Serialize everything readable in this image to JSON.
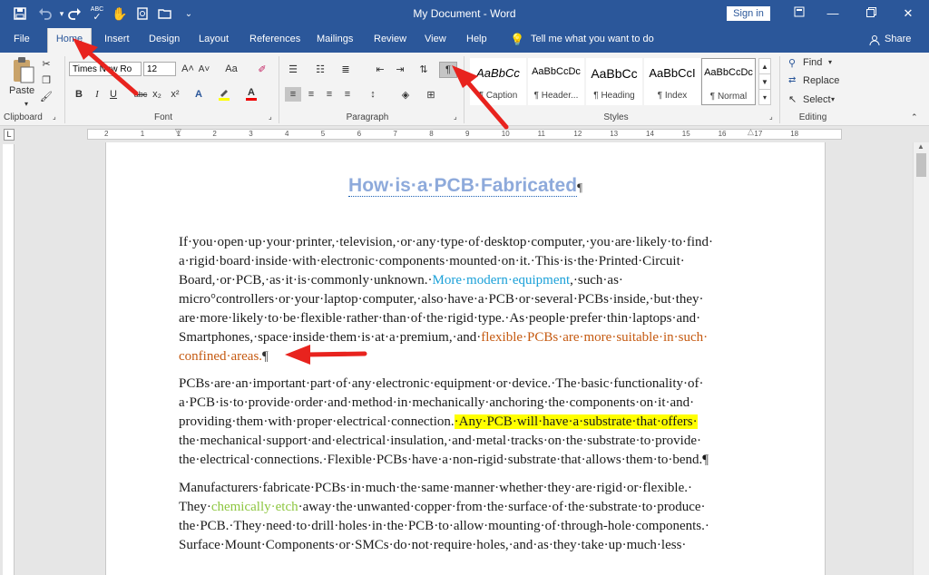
{
  "titlebar": {
    "title": "My Document - Word",
    "signin": "Sign in",
    "colors": {
      "ribbon_blue": "#2b579a"
    }
  },
  "quick_access": {
    "icons": [
      "save-icon",
      "undo-icon",
      "redo-icon",
      "spelling-check-icon",
      "touch-mode-icon",
      "print-preview-icon",
      "open-folder-icon",
      "customize-icon"
    ],
    "spelling_label": "ABC"
  },
  "tabs": {
    "file": "File",
    "home": "Home",
    "insert": "Insert",
    "design": "Design",
    "layout": "Layout",
    "references": "References",
    "mailings": "Mailings",
    "review": "Review",
    "view": "View",
    "help": "Help",
    "tell_me": "Tell me what you want to do",
    "share": "Share"
  },
  "ribbon": {
    "clipboard": {
      "label": "Clipboard",
      "paste": "Paste"
    },
    "font": {
      "label": "Font",
      "font_name": "Times New Ro",
      "font_size": "12",
      "grow": "A˄",
      "shrink": "A˅",
      "case": "Aa",
      "bold": "B",
      "italic": "I",
      "underline": "U",
      "strike": "abc",
      "subscript": "x₂",
      "superscript": "x²",
      "effects": "A",
      "font_color": "A"
    },
    "paragraph": {
      "label": "Paragraph",
      "show_marks": "¶"
    },
    "styles": {
      "label": "Styles",
      "items": [
        {
          "sample": "AaBbCc",
          "name": "¶ Caption"
        },
        {
          "sample": "AaBbCcDc",
          "name": "¶ Header..."
        },
        {
          "sample": "AaBbCc",
          "name": "¶ Heading"
        },
        {
          "sample": "AaBbCcI",
          "name": "¶ Index"
        },
        {
          "sample": "AaBbCcDc",
          "name": "¶ Normal"
        }
      ]
    },
    "editing": {
      "label": "Editing",
      "find": "Find",
      "replace": "Replace",
      "select": "Select"
    }
  },
  "ruler": {
    "numbers": [
      "2",
      "1",
      "1",
      "2",
      "3",
      "4",
      "5",
      "6",
      "7",
      "8",
      "9",
      "10",
      "11",
      "12",
      "13",
      "14",
      "15",
      "16",
      "17",
      "18"
    ]
  },
  "document": {
    "heading": "How·is·a·PCB·Fabricated",
    "heading_mark": "¶",
    "p1": {
      "l1": "If·you·open·up·your·printer,·television,·or·any·type·of·desktop·computer,·you·are·likely·to·find·",
      "l2": "a·rigid·board·inside·with·electronic·components·mounted·on·it.·This·is·the·Printed·Circuit·",
      "l3a": "Board,·or·PCB,·as·it·is·commonly·unknown.·",
      "l3b": "More·modern·equipment",
      "l3c": ",·such·as·",
      "l4": "micro°controllers·or·your·laptop·computer,·also·have·a·PCB·or·several·PCBs·inside,·but·they·",
      "l5": "are·more·likely·to·be·flexible·rather·than·of·the·rigid·type.·As·people·prefer·thin·laptops·and·",
      "l6a": "Smartphones,·space·inside·them·is·at·a·premium,·and·",
      "l6b": "flexible·PCBs·are·more·suitable·in·such·",
      "l7a": "confined·areas.",
      "l7b": "¶"
    },
    "p2": {
      "l1": "PCBs·are·an·important·part·of·any·electronic·equipment·or·device.·The·basic·functionality·of·",
      "l2": "a·PCB·is·to·provide·order·and·method·in·mechanically·anchoring·the·components·on·it·and·",
      "l3a": "providing·them·with·proper·electrical·connection.",
      "l3b": "·Any·PCB·will·have·a·substrate·that·offers·",
      "l4": "the·mechanical·support·and·electrical·insulation,·and·metal·tracks·on·the·substrate·to·provide·",
      "l5": "the·electrical·connections.·Flexible·PCBs·have·a·non-rigid·substrate·that·allows·them·to·bend.¶"
    },
    "p3": {
      "l1": "Manufacturers·fabricate·PCBs·in·much·the·same·manner·whether·they·are·rigid·or·flexible.·",
      "l2a": "They·",
      "l2b": "chemically·etch",
      "l2c": "·away·the·unwanted·copper·from·the·surface·of·the·substrate·to·produce·",
      "l3": "the·PCB.·They·need·to·drill·holes·in·the·PCB·to·allow·mounting·of·through-hole·components.·",
      "l4": "Surface·Mount·Components·or·SMCs·do·not·require·holes,·and·as·they·take·up·much·less·"
    },
    "colors": {
      "heading": "#8eaadb",
      "blue_text": "#1aa0d8",
      "orange_text": "#c55a11",
      "green_text": "#8dc63f",
      "highlight": "#ffff00"
    }
  },
  "annotations": {
    "arrow_color": "#e8231e",
    "arrows": [
      "arrow-to-home-tab",
      "arrow-to-show-marks-button",
      "arrow-to-paragraph-mark"
    ]
  }
}
